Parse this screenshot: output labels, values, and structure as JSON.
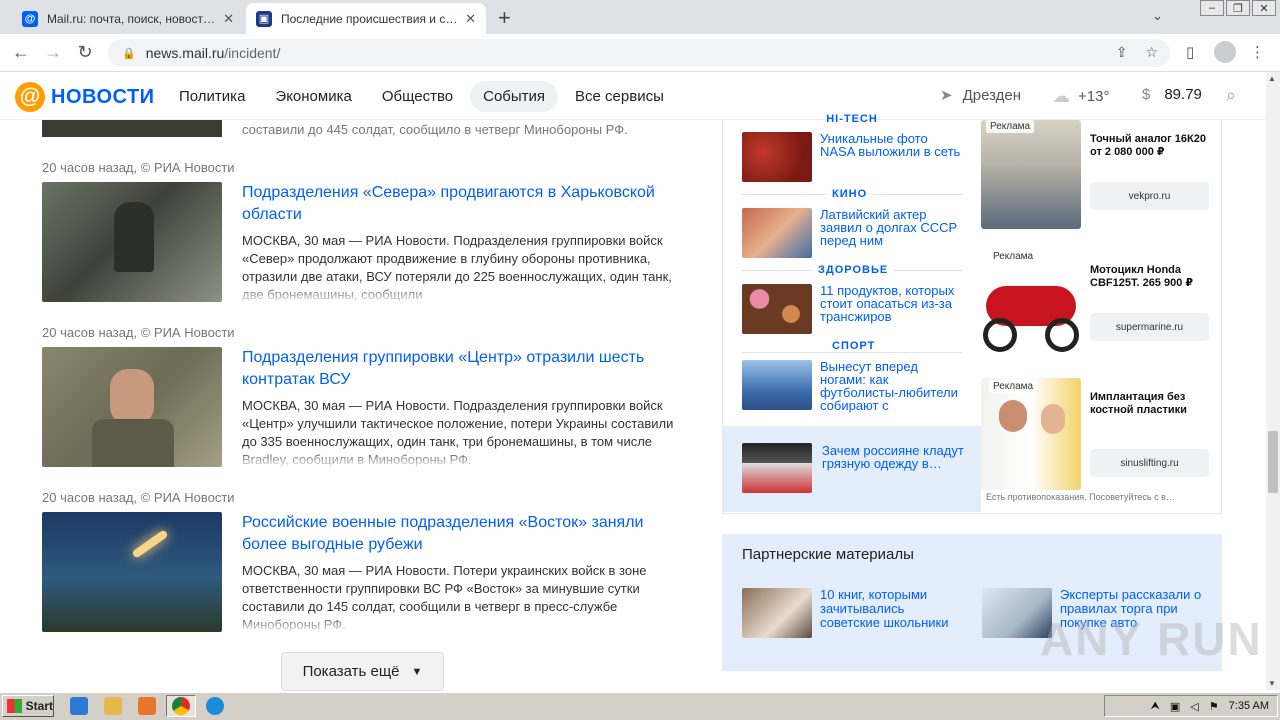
{
  "browser": {
    "tabs": [
      {
        "title": "Mail.ru: почта, поиск, новости, пр…",
        "active": false
      },
      {
        "title": "Последние происшествия и событ…",
        "active": true
      }
    ],
    "new_tab": "+",
    "url_host": "news.mail.ru",
    "url_path": "/incident/",
    "tab_list_icon": "chevron-down-icon"
  },
  "site": {
    "logo_at": "@",
    "logo_word": "НОВОСТИ",
    "nav": [
      "Политика",
      "Экономика",
      "Общество",
      "События",
      "Все сервисы"
    ],
    "active_nav": "События",
    "city": "Дрезден",
    "temperature": "+13°",
    "currency_symbol": "$",
    "currency_value": "89.79"
  },
  "feed": {
    "partial_top_text": "составили до 445 солдат, сообщило в четверг Минобороны РФ.",
    "articles": [
      {
        "meta": "20 часов назад, © РИА Новости",
        "title": "Подразделения «Севера» продвигаются в Харьковской области",
        "text": "МОСКВА, 30 мая — РИА Новости. Подразделения группировки войск «Север» продолжают продвижение в глубину обороны противника, отразили две атаки, ВСУ потеряли до 225 военнослужащих, один танк, две бронемашины, сообщили"
      },
      {
        "meta": "20 часов назад, © РИА Новости",
        "title": "Подразделения группировки «Центр» отразили шесть контратак ВСУ",
        "text": "МОСКВА, 30 мая — РИА Новости. Подразделения группировки войск «Центр» улучшили тактическое положение, потери Украины составили до 335 военнослужащих, один танк, три бронемашины, в том числе Bradley, сообщили в Минобороны РФ."
      },
      {
        "meta": "20 часов назад, © РИА Новости",
        "title": "Российские военные подразделения «Восток» заняли более выгодные рубежи",
        "text": "МОСКВА, 30 мая — РИА Новости. Потери украинских войск в зоне ответственности группировки ВС РФ «Восток» за минувшие сутки составили до 145 солдат, сообщили в четверг в пресс-службе Минобороны РФ."
      }
    ],
    "show_more": "Показать ещё"
  },
  "sidebar": {
    "sections": [
      {
        "category": "HI-TECH",
        "text": "Уникальные фото NASA выложили в сеть"
      },
      {
        "category": "КИНО",
        "text": "Латвийский актер заявил о долгах СССР перед ним"
      },
      {
        "category": "ЗДОРОВЬЕ",
        "text": "11 продуктов, которых стоит опасаться из-за трансжиров"
      },
      {
        "category": "СПОРТ",
        "text": "Вынесут вперед ногами: как футболисты-любители собирают с"
      }
    ],
    "promo": "Зачем россияне кладут грязную одежду в…",
    "ads": [
      {
        "tag": "Реклама",
        "title": "Точный аналог 16К20 от 2 080 000 ₽",
        "domain": "vekpro.ru"
      },
      {
        "tag": "Реклама",
        "title": "Мотоцикл Honda CBF125T. 265 900 ₽",
        "domain": "supermarine.ru"
      },
      {
        "tag": "Реклама",
        "title": "Имплантация без костной пластики",
        "domain": "sinuslifting.ru"
      }
    ],
    "ad_disclaimer": "Есть противопоказания. Посоветуйтесь с в…",
    "partner_heading": "Партнерские материалы",
    "partner_items": [
      "10 книг, которыми зачитывались советские школьники",
      "Эксперты рассказали о правилах торга при покупке авто"
    ]
  },
  "taskbar": {
    "start": "Start",
    "clock": "7:35 AM"
  },
  "watermark": "ANY RUN",
  "colors": {
    "link": "#005ff9",
    "logo_orange": "#ff9e00",
    "partner_bg": "#e3edfb"
  }
}
